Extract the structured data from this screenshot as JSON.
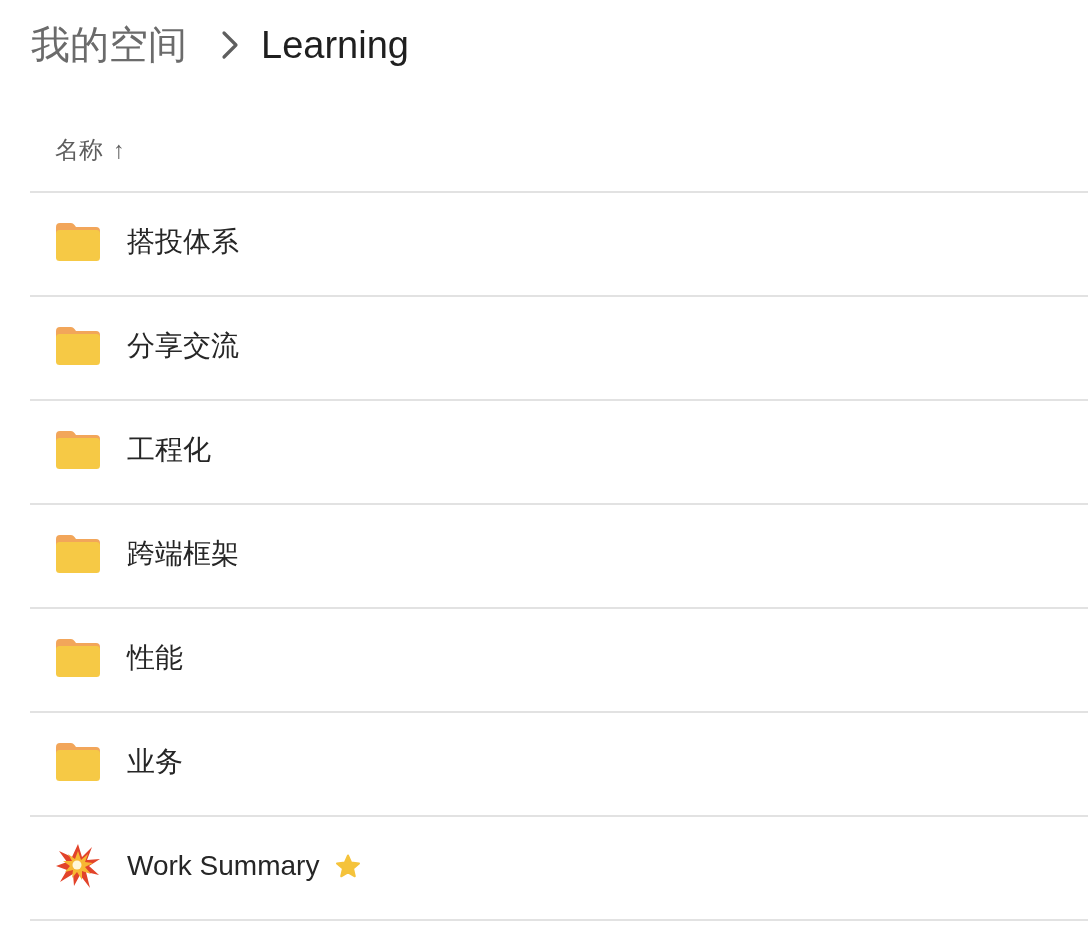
{
  "breadcrumb": [
    {
      "label": "我的空间",
      "current": false
    },
    {
      "label": "Learning",
      "current": true
    }
  ],
  "column_header": {
    "label": "名称",
    "sort_indicator": "↑"
  },
  "items": [
    {
      "kind": "folder",
      "name": "搭投体系",
      "starred": false
    },
    {
      "kind": "folder",
      "name": "分享交流",
      "starred": false
    },
    {
      "kind": "folder",
      "name": "工程化",
      "starred": false
    },
    {
      "kind": "folder",
      "name": "跨端框架",
      "starred": false
    },
    {
      "kind": "folder",
      "name": "性能",
      "starred": false
    },
    {
      "kind": "folder",
      "name": "业务",
      "starred": false
    },
    {
      "kind": "document",
      "name": "Work Summary",
      "starred": true
    }
  ]
}
